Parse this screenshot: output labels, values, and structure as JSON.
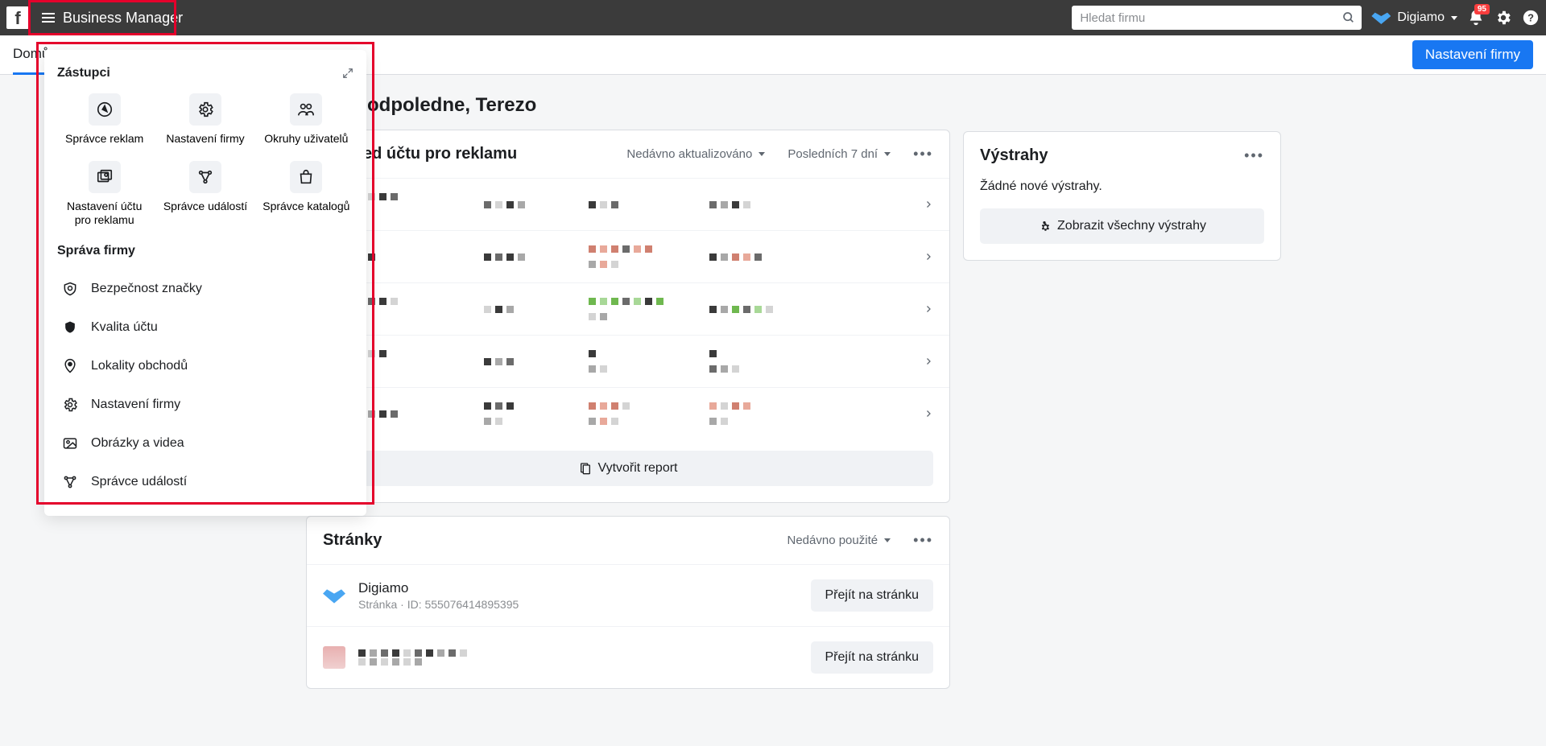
{
  "topbar": {
    "app_title": "Business Manager",
    "search_placeholder": "Hledat firmu",
    "business_name": "Digiamo",
    "notif_count": "95"
  },
  "subbar": {
    "tab_home": "Domů",
    "settings_btn": "Nastavení firmy"
  },
  "mega": {
    "shortcuts_heading": "Zástupci",
    "shortcuts": [
      {
        "label": "Správce reklam"
      },
      {
        "label": "Nastavení firmy"
      },
      {
        "label": "Okruhy uživatelů"
      },
      {
        "label": "Nastavení účtu pro reklamu"
      },
      {
        "label": "Správce událostí"
      },
      {
        "label": "Správce katalogů"
      }
    ],
    "manage_heading": "Správa firmy",
    "manage_items": [
      {
        "label": "Bezpečnost značky"
      },
      {
        "label": "Kvalita účtu"
      },
      {
        "label": "Lokality obchodů"
      },
      {
        "label": "Nastavení firmy"
      },
      {
        "label": "Obrázky a videa"
      },
      {
        "label": "Správce událostí"
      }
    ]
  },
  "main": {
    "greeting": "Dobré odpoledne, Terezo",
    "adaccounts": {
      "title": "Přehled účtu pro reklamu",
      "filter1": "Nedávno aktualizováno",
      "filter2": "Posledních 7 dní",
      "report_btn": "Vytvořit report"
    },
    "pages": {
      "title": "Stránky",
      "filter": "Nedávno použité",
      "goto_btn": "Přejít na stránku",
      "items": [
        {
          "name": "Digiamo",
          "sub": "Stránka · ID: 555076414895395"
        },
        {
          "name": "",
          "sub": ""
        }
      ]
    },
    "alerts": {
      "title": "Výstrahy",
      "empty": "Žádné nové výstrahy.",
      "view_all": "Zobrazit všechny výstrahy"
    }
  }
}
